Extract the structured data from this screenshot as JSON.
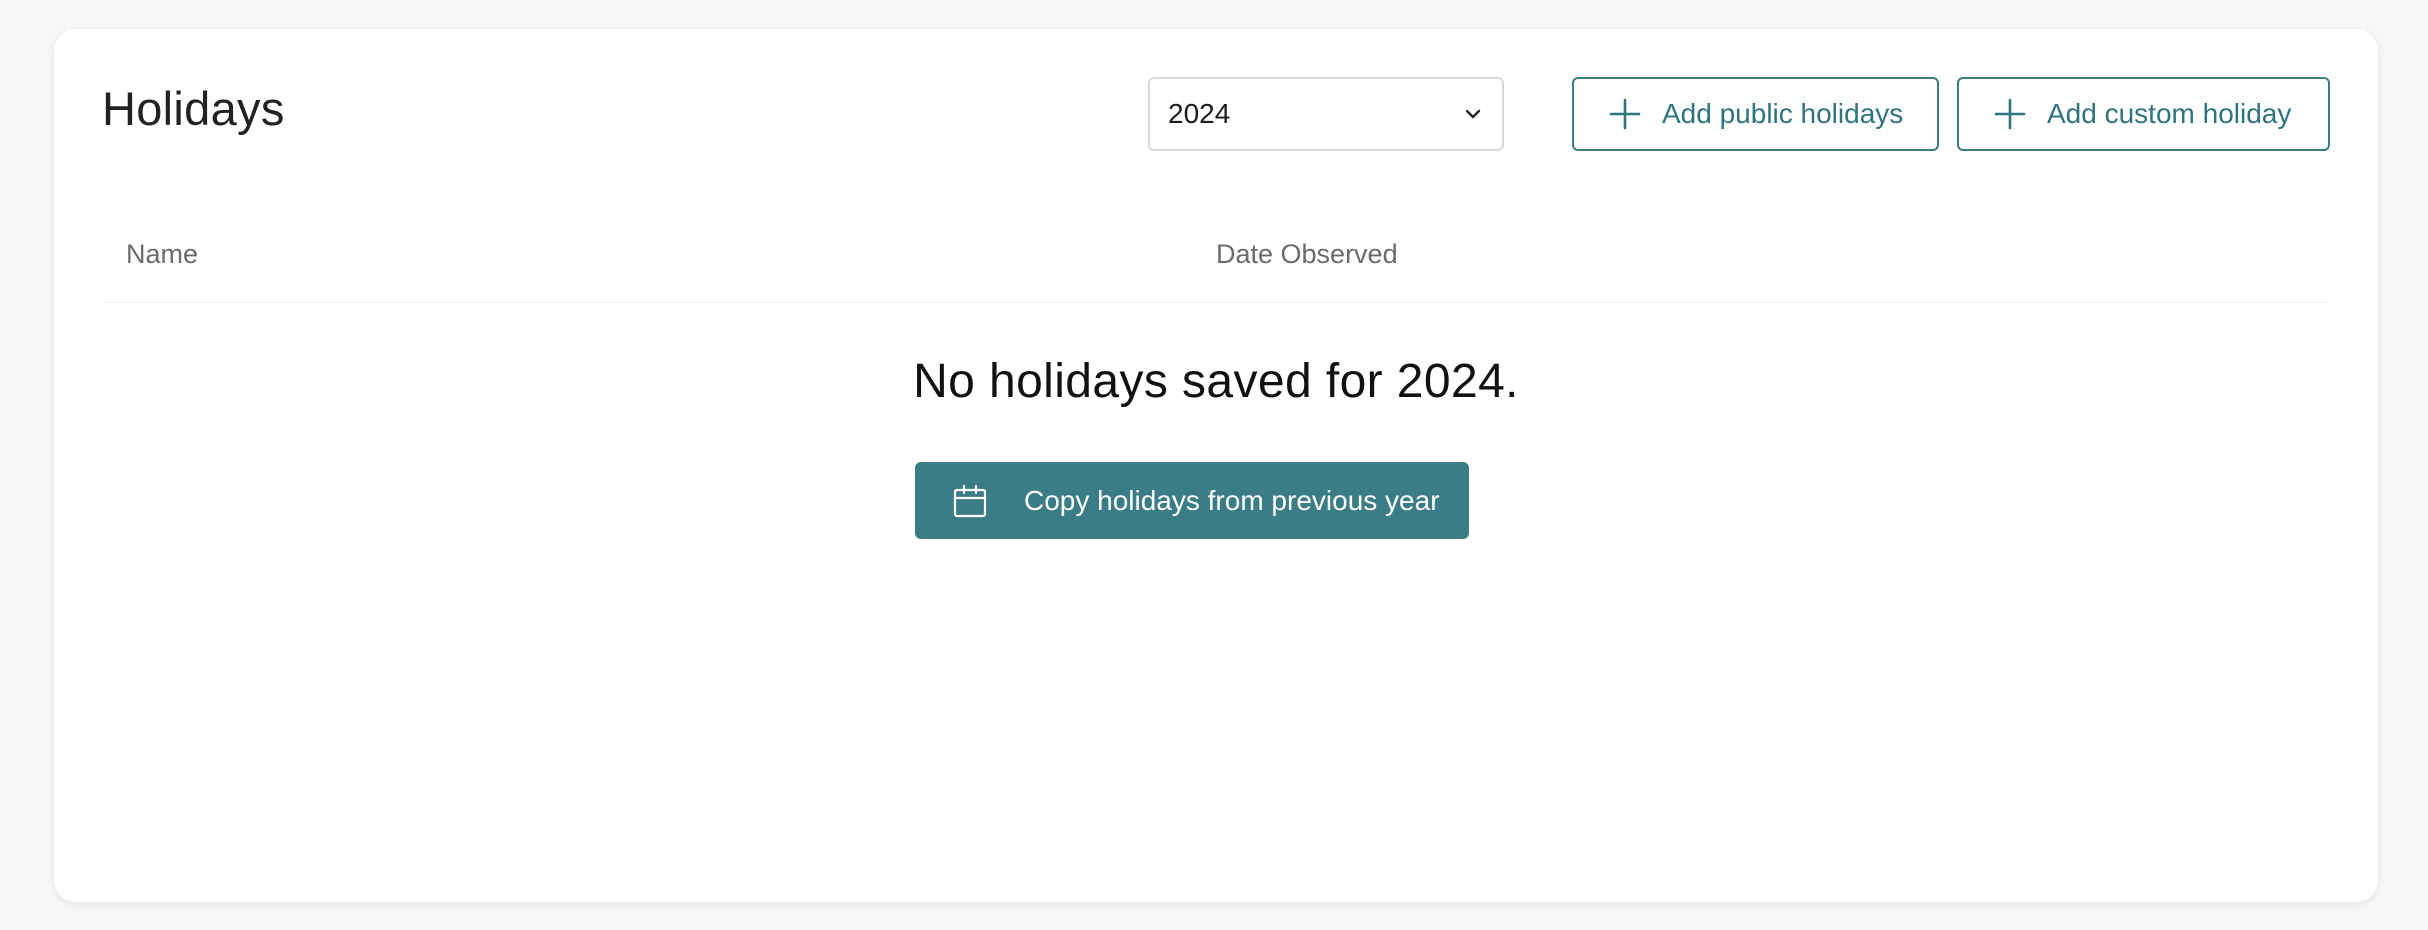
{
  "page": {
    "title": "Holidays"
  },
  "year_select": {
    "value": "2024",
    "icon": "chevron-down-icon"
  },
  "actions": {
    "add_public_label": "Add public holidays",
    "add_custom_label": "Add custom holiday",
    "icon": "plus-icon"
  },
  "table": {
    "columns": [
      "Name",
      "Date Observed"
    ]
  },
  "empty_state": {
    "message": "No holidays saved for 2024.",
    "copy_button_label": "Copy holidays from previous year",
    "copy_button_icon": "calendar-icon"
  },
  "colors": {
    "accent": "#3a7d87",
    "background": "#f7f7f7",
    "card": "#ffffff"
  }
}
